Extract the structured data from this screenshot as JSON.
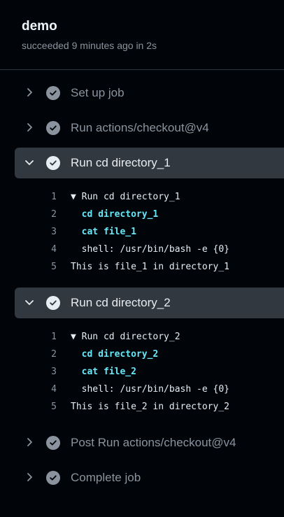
{
  "job": {
    "title": "demo",
    "status": "succeeded 9 minutes ago in 2s"
  },
  "steps": [
    {
      "label": "Set up job",
      "expanded": false
    },
    {
      "label": "Run actions/checkout@v4",
      "expanded": false
    },
    {
      "label": "Run cd directory_1",
      "expanded": true
    },
    {
      "label": "Run cd directory_2",
      "expanded": true
    },
    {
      "label": "Post Run actions/checkout@v4",
      "expanded": false
    },
    {
      "label": "Complete job",
      "expanded": false
    }
  ],
  "logs": {
    "step3": [
      {
        "num": "1",
        "text": "▼ Run cd directory_1"
      },
      {
        "num": "2",
        "text": "  cd directory_1"
      },
      {
        "num": "3",
        "text": "  cat file_1"
      },
      {
        "num": "4",
        "text": "  shell: /usr/bin/bash -e {0}"
      },
      {
        "num": "5",
        "text": "This is file_1 in directory_1"
      }
    ],
    "step4": [
      {
        "num": "1",
        "text": "▼ Run cd directory_2"
      },
      {
        "num": "2",
        "text": "  cd directory_2"
      },
      {
        "num": "3",
        "text": "  cat file_2"
      },
      {
        "num": "4",
        "text": "  shell: /usr/bin/bash -e {0}"
      },
      {
        "num": "5",
        "text": "This is file_2 in directory_2"
      }
    ]
  },
  "colors": {
    "background": "#010409",
    "expanded_step": "#32383f",
    "muted_text": "#8b949e",
    "command_text": "#67e8f9"
  }
}
